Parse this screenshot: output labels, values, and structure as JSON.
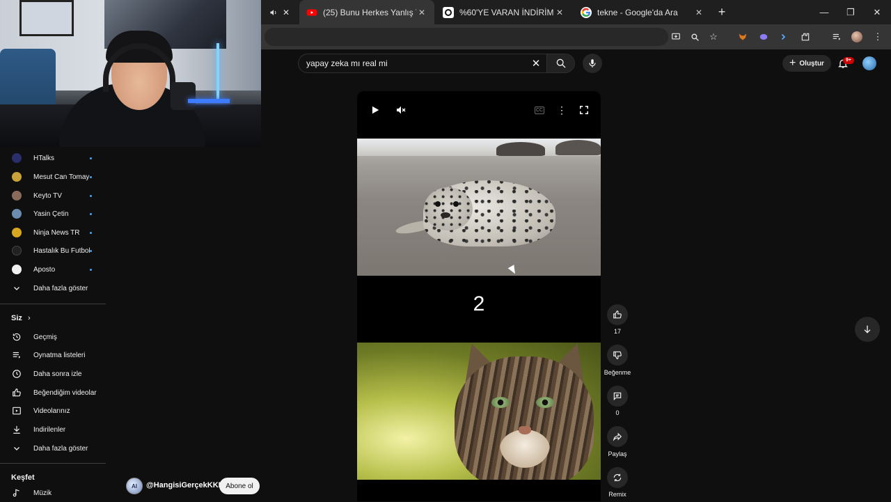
{
  "browser": {
    "tabs": [
      {
        "title": "(25) Bunu Herkes Yanlış Tahmin",
        "active": true,
        "favicon": "youtube-favicon"
      },
      {
        "title": "%60'YE VARAN İNDİRİM",
        "active": false,
        "favicon": "shop-favicon"
      },
      {
        "title": "tekne - Google'da Ara",
        "active": false,
        "favicon": "google-favicon"
      }
    ],
    "new_tab": "+",
    "window_controls": {
      "minimize": "—",
      "maximize": "❐",
      "close": "✕"
    }
  },
  "youtube": {
    "search_value": "yapay zeka mı real mi",
    "create_label": "Oluştur",
    "notification_badge": "9+"
  },
  "sidebar": {
    "subscriptions": [
      {
        "label": "HTalks",
        "avatar_color": "#2a2f6b"
      },
      {
        "label": "Mesut Can Tomay",
        "avatar_color": "#c9a13b"
      },
      {
        "label": "Keyto TV",
        "avatar_color": "#8a6a5a"
      },
      {
        "label": "Yasin Çetin",
        "avatar_color": "#6b8cae"
      },
      {
        "label": "Ninja News TR",
        "avatar_color": "#d9a620"
      },
      {
        "label": "Hastalık Bu Futbol",
        "avatar_color": "#222222"
      },
      {
        "label": "Aposto",
        "avatar_color": "#f1f1f1"
      }
    ],
    "show_more_1": "Daha fazla göster",
    "you_heading": "Siz",
    "you_items": [
      {
        "label": "Geçmiş",
        "icon": "history-icon"
      },
      {
        "label": "Oynatma listeleri",
        "icon": "playlist-icon"
      },
      {
        "label": "Daha sonra izle",
        "icon": "clock-icon"
      },
      {
        "label": "Beğendiğim videolar",
        "icon": "thumbs-up-icon"
      },
      {
        "label": "Videolarınız",
        "icon": "video-icon"
      },
      {
        "label": "İndirilenler",
        "icon": "download-icon"
      }
    ],
    "show_more_2": "Daha fazla göster",
    "explore_heading": "Keşfet",
    "explore_items": [
      {
        "label": "Müzik",
        "icon": "music-icon"
      }
    ]
  },
  "short": {
    "number_text": "2",
    "actions": {
      "like_count": "17",
      "dislike_label": "Beğenme",
      "comment_count": "0",
      "share_label": "Paylaş",
      "remix_label": "Remix"
    },
    "channel_name": "@HangisiGerçekKKK",
    "channel_avatar_text": "AI",
    "subscribe_label": "Abone ol"
  }
}
